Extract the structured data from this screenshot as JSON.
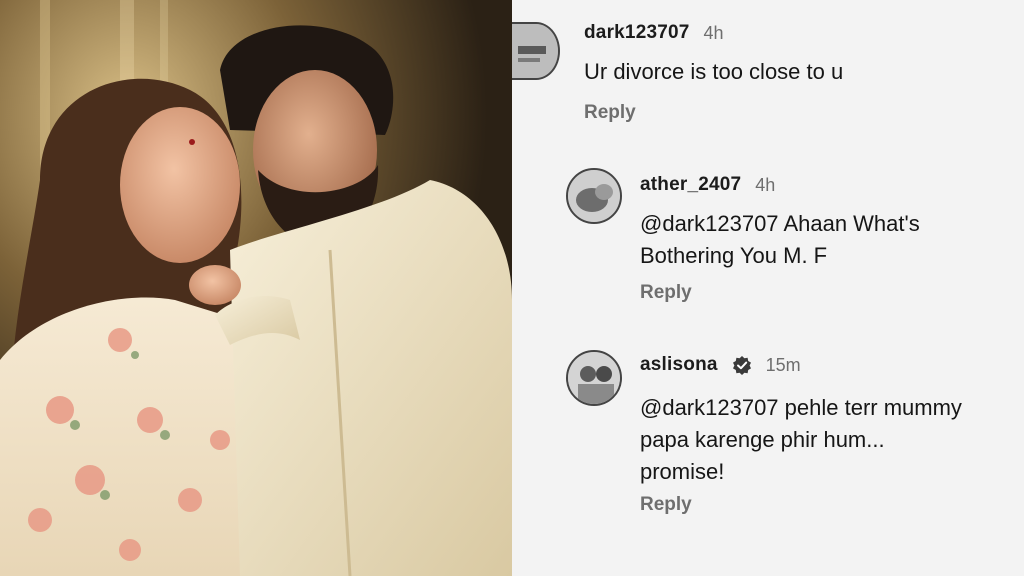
{
  "comments": [
    {
      "username": "dark123707",
      "time": "4h",
      "text": "Ur divorce is too close to u",
      "reply_label": "Reply",
      "avatar_icon": "profile-avatar",
      "verified": false
    },
    {
      "username": "ather_2407",
      "time": "4h",
      "text_line1": "@dark123707 Ahaan What's",
      "text_line2": "Bothering You M. F",
      "reply_label": "Reply",
      "avatar_icon": "profile-avatar",
      "verified": false
    },
    {
      "username": "aslisona",
      "time": "15m",
      "text_line1": "@dark123707 pehle terr mummy",
      "text_line2": "papa karenge phir hum...",
      "text_line3": "promise!",
      "reply_label": "Reply",
      "avatar_icon": "profile-avatar",
      "verified": true
    }
  ],
  "photo": {
    "description_icon": "couple-photo"
  },
  "colors": {
    "panel_bg": "#f3f3f3",
    "username": "#1c1c1c",
    "meta_gray": "#6e6e6e",
    "verified_badge": "#3a3a3a"
  }
}
